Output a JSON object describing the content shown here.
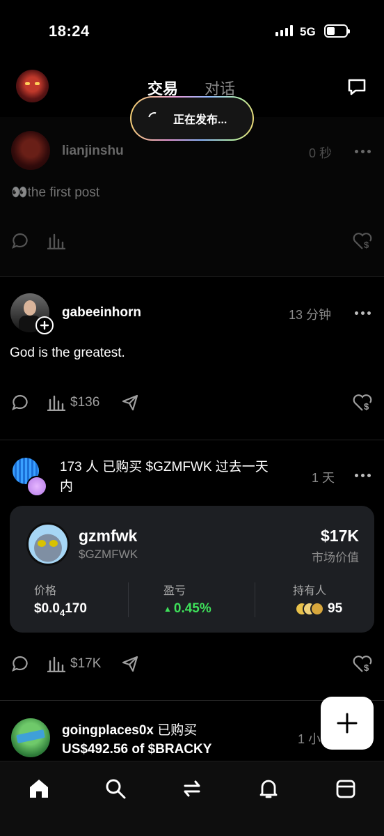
{
  "status_bar": {
    "time": "18:24",
    "network": "5G"
  },
  "header": {
    "tabs": [
      {
        "label": "交易"
      },
      {
        "label": "对话"
      }
    ],
    "publishing_label": "正在发布..."
  },
  "posts": [
    {
      "username": "lianjinshu",
      "time": "0 秒",
      "text": "👀the first post"
    },
    {
      "username": "gabeeinhorn",
      "time": "13 分钟",
      "text": "God is the greatest.",
      "views_value": "$136"
    },
    {
      "activity": "173 人 已购买 $GZMFWK 过去一天",
      "activity_cont": "内",
      "time": "1 天",
      "views_value": "$17K",
      "token": {
        "name": "gzmfwk",
        "ticker": "$GZMFWK",
        "market_cap": "$17K",
        "market_cap_label": "市场价值",
        "price_label": "价格",
        "price_main": "$0.0",
        "price_sub": "4",
        "price_tail": "170",
        "pnl_label": "盈亏",
        "pnl_value": "0.45%",
        "holders_label": "持有人",
        "holders_value": "95"
      }
    },
    {
      "username": "goingplaces0x",
      "action": "已购买",
      "amount": "US$492.56 of $BRACKY",
      "time": "1 小"
    }
  ],
  "colors": {
    "positive": "#3ee05a",
    "background": "#000000",
    "card": "#1d1f23"
  },
  "nav": [
    "home-icon",
    "search-icon",
    "swap-icon",
    "bell-icon",
    "wallet-icon"
  ]
}
